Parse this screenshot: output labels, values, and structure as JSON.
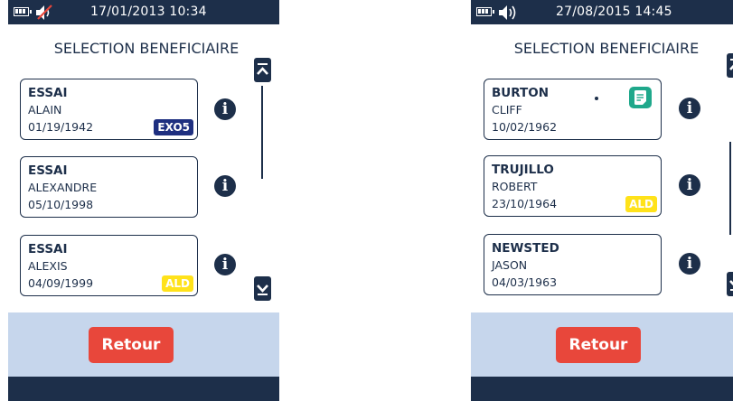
{
  "screens": [
    {
      "datetime": "17/01/2013 10:34",
      "title": "SELECTION BENEFICIAIRE",
      "beneficiaries": [
        {
          "name": "ESSAI",
          "first_name": "ALAIN",
          "dob": "01/19/1942",
          "badge": "EXO5"
        },
        {
          "name": "ESSAI",
          "first_name": "ALEXANDRE",
          "dob": "05/10/1998"
        },
        {
          "name": "ESSAI",
          "first_name": "ALEXIS",
          "dob": "04/09/1999",
          "badge": "ALD"
        }
      ],
      "back_label": "Retour",
      "sound": "muted"
    },
    {
      "datetime": "27/08/2015 14:45",
      "title": "SELECTION BENEFICIAIRE",
      "beneficiaries": [
        {
          "name": "BURTON",
          "first_name": "CLIFF",
          "dob": "10/02/1962",
          "icon": "note-icon"
        },
        {
          "name": "TRUJILLO",
          "first_name": "ROBERT",
          "dob": "23/10/1964",
          "badge": "ALD"
        },
        {
          "name": "NEWSTED",
          "first_name": "JASON",
          "dob": "04/03/1963"
        }
      ],
      "back_label": "Retour",
      "sound": "on"
    }
  ],
  "icons": {
    "info": "i"
  },
  "colors": {
    "navy": "#1d2f4a",
    "retour_button": "#e8473b",
    "bottom_panel": "#c6d6ec",
    "exo_badge": "#1e2f80",
    "ald_badge": "#ffe21a",
    "note_icon": "#1fa88b"
  }
}
